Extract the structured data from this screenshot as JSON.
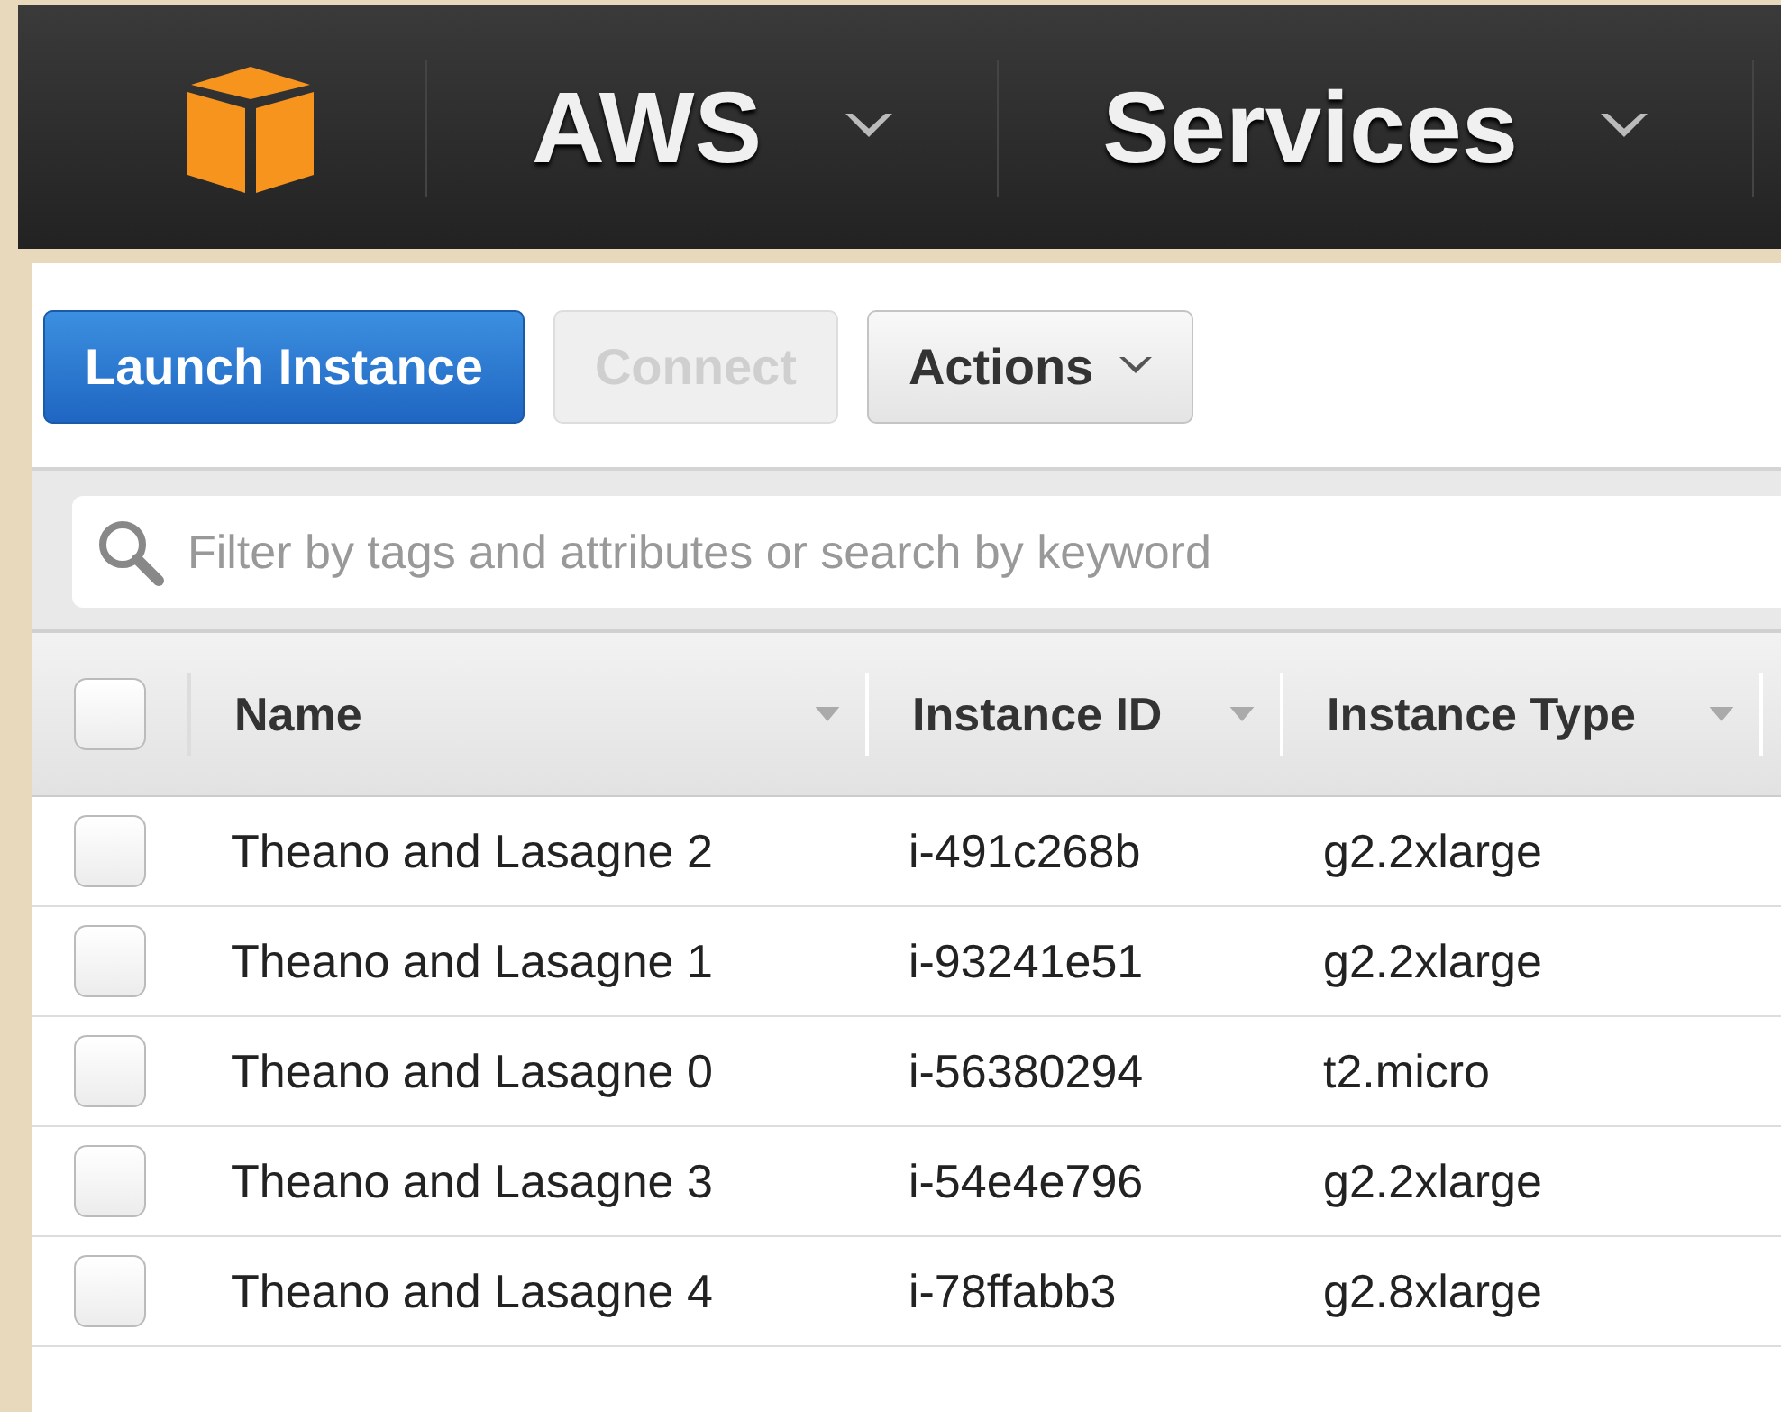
{
  "nav": {
    "items": [
      {
        "label": "AWS"
      },
      {
        "label": "Services"
      }
    ]
  },
  "toolbar": {
    "buttons": [
      {
        "label": "Launch Instance",
        "kind": "primary",
        "disabled": false
      },
      {
        "label": "Connect",
        "kind": "plain",
        "disabled": true
      },
      {
        "label": "Actions",
        "kind": "menu",
        "disabled": false
      }
    ]
  },
  "filter": {
    "placeholder": "Filter by tags and attributes or search by keyword"
  },
  "table": {
    "select_all_checked": false,
    "columns": [
      "Name",
      "Instance ID",
      "Instance Type"
    ],
    "rows": [
      {
        "checked": false,
        "cells": [
          "Theano and Lasagne 2",
          "i-491c268b",
          "g2.2xlarge"
        ]
      },
      {
        "checked": false,
        "cells": [
          "Theano and Lasagne 1",
          "i-93241e51",
          "g2.2xlarge"
        ]
      },
      {
        "checked": false,
        "cells": [
          "Theano and Lasagne 0",
          "i-56380294",
          "t2.micro"
        ]
      },
      {
        "checked": false,
        "cells": [
          "Theano and Lasagne 3",
          "i-54e4e796",
          "g2.2xlarge"
        ]
      },
      {
        "checked": false,
        "cells": [
          "Theano and Lasagne 4",
          "i-78ffabb3",
          "g2.8xlarge"
        ]
      }
    ]
  }
}
